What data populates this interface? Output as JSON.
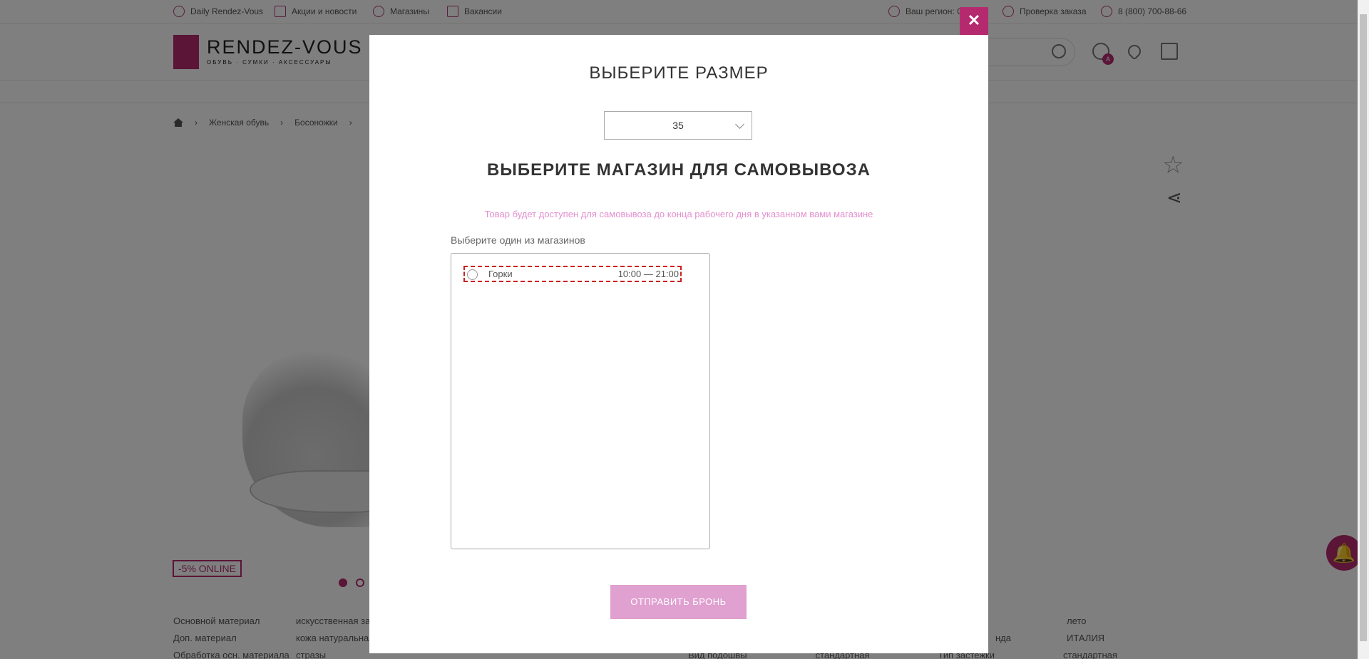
{
  "topbar": {
    "daily": "Daily Rendez-Vous",
    "promos": "Акции и новости",
    "stores": "Магазины",
    "jobs": "Вакансии",
    "region": "Ваш регион: С",
    "order_check": "Проверка заказа",
    "phone": "8 (800) 700-88-66"
  },
  "header": {
    "logo": "RENDEZ-VOUS",
    "logo_sub": "ОБУВЬ · СУМКИ · АКСЕССУАРЫ",
    "user_badge": "А"
  },
  "breadcrumbs": [
    "Женская обувь",
    "Босоножки"
  ],
  "product": {
    "promo_badge": "-5% ONLINE"
  },
  "specs": {
    "left": [
      {
        "k": "Основной материал",
        "v": "искусственная за"
      },
      {
        "k": "Доп. материал",
        "v": "кожа натуральная"
      },
      {
        "k": "Обработка осн. материала",
        "v": "стразы"
      }
    ],
    "middle": [
      {
        "k": "Вид подошвы",
        "v": "стандартная"
      },
      {
        "k": "Тип застежки",
        "v": "стандартная"
      }
    ],
    "middle_fragment": "нда",
    "right": [
      "лето",
      "ИТАЛИЯ"
    ]
  },
  "modal": {
    "close_label": "✕",
    "size_title": "ВЫБЕРИТЕ РАЗМЕР",
    "size_value": "35",
    "store_title": "ВЫБЕРИТЕ МАГАЗИН ДЛЯ САМОВЫВОЗА",
    "notice": "Товар будет доступен для самовывоза до конца рабочего дня в указанном вами магазине",
    "pick_label": "Выберите один из магазинов",
    "stores": [
      {
        "name": "Горки",
        "hours": "10:00 — 21:00"
      }
    ],
    "submit_label": "ОТПРАВИТЬ БРОНЬ"
  },
  "colors": {
    "brand": "#b52a6f",
    "notice": "#e38fcf",
    "submit_bg": "#e0a0d0",
    "highlight": "#cc1f1f"
  }
}
